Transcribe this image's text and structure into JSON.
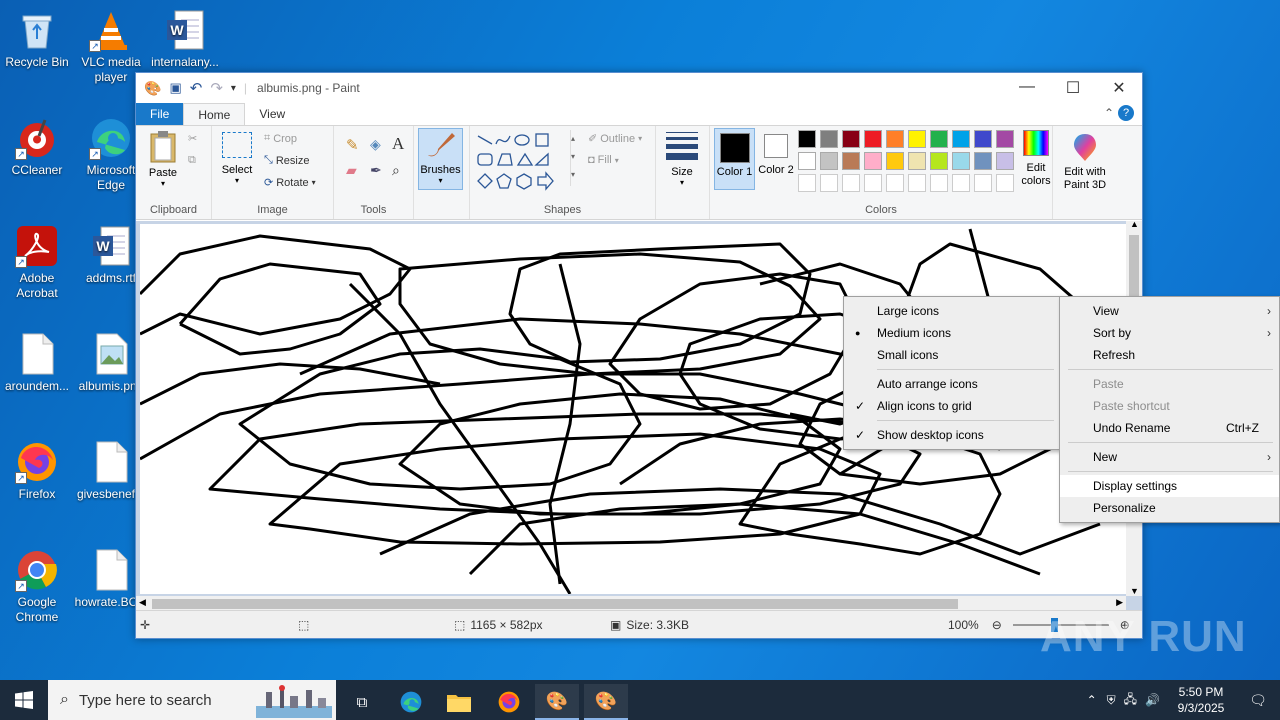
{
  "desktop_icons": [
    {
      "label": "Recycle Bin",
      "icon": "recycle-bin-icon"
    },
    {
      "label": "VLC media player",
      "icon": "vlc-icon"
    },
    {
      "label": "internalany...",
      "icon": "word-doc-icon"
    },
    {
      "label": "CCleaner",
      "icon": "ccleaner-icon"
    },
    {
      "label": "Microsoft Edge",
      "icon": "edge-icon"
    },
    {
      "label": "Adobe Acrobat",
      "icon": "acrobat-icon"
    },
    {
      "label": "addms.rtf",
      "icon": "word-doc-icon"
    },
    {
      "label": "aroundem...",
      "icon": "blank-file-icon"
    },
    {
      "label": "albumis.png",
      "icon": "image-file-icon"
    },
    {
      "label": "Firefox",
      "icon": "firefox-icon"
    },
    {
      "label": "givesbenef...",
      "icon": "blank-file-icon"
    },
    {
      "label": "Google Chrome",
      "icon": "chrome-icon"
    },
    {
      "label": "howrate.BC...",
      "icon": "blank-file-icon"
    }
  ],
  "paint": {
    "title": "albumis.png - Paint",
    "tabs": {
      "file": "File",
      "home": "Home",
      "view": "View"
    },
    "clipboard": {
      "paste": "Paste",
      "label": "Clipboard"
    },
    "image": {
      "select": "Select",
      "crop": "Crop",
      "resize": "Resize",
      "rotate": "Rotate",
      "label": "Image"
    },
    "tools": {
      "label": "Tools"
    },
    "brushes": "Brushes",
    "shapes": {
      "outline": "Outline",
      "fill": "Fill",
      "label": "Shapes"
    },
    "size": "Size",
    "colors": {
      "color1": "Color 1",
      "color2": "Color 2",
      "edit": "Edit colors",
      "label": "Colors",
      "palette_row1": [
        "#000000",
        "#7f7f7f",
        "#880015",
        "#ed1c24",
        "#ff7f27",
        "#fff200",
        "#22b14c",
        "#00a2e8",
        "#3f48cc",
        "#a349a4"
      ],
      "palette_row2": [
        "#ffffff",
        "#c3c3c3",
        "#b97a57",
        "#ffaec9",
        "#ffc90e",
        "#efe4b0",
        "#b5e61d",
        "#99d9ea",
        "#7092be",
        "#c8bfe7"
      ]
    },
    "edit3d": "Edit with Paint 3D",
    "status": {
      "dimensions": "1165 × 582px",
      "size": "Size: 3.3KB",
      "zoom": "100%"
    }
  },
  "view_menu": {
    "items": [
      {
        "label": "Large icons",
        "mark": ""
      },
      {
        "label": "Medium icons",
        "mark": "●"
      },
      {
        "label": "Small icons",
        "mark": ""
      },
      {
        "label": "Auto arrange icons",
        "mark": ""
      },
      {
        "label": "Align icons to grid",
        "mark": "✓"
      },
      {
        "label": "Show desktop icons",
        "mark": "✓"
      }
    ]
  },
  "desktop_menu": {
    "view": "View",
    "sort_by": "Sort by",
    "refresh": "Refresh",
    "paste": "Paste",
    "paste_shortcut": "Paste shortcut",
    "undo_rename": "Undo Rename",
    "undo_shortcut": "Ctrl+Z",
    "new": "New",
    "display_settings": "Display settings",
    "personalize": "Personalize"
  },
  "taskbar": {
    "search_placeholder": "Type here to search",
    "time": "5:50 PM",
    "date": "9/3/2025"
  },
  "watermark": "ANY RUN"
}
